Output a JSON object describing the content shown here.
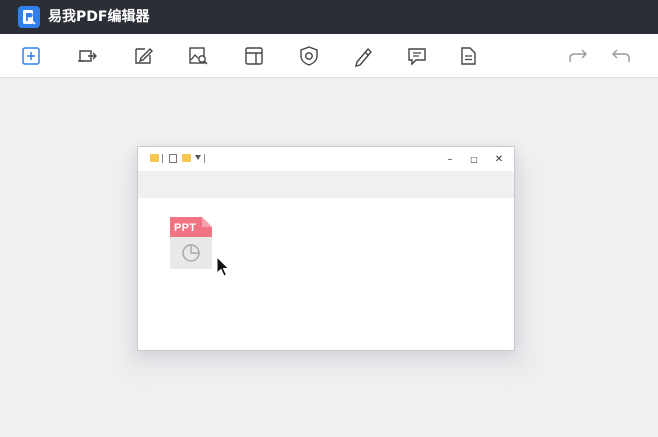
{
  "app": {
    "title": "易我PDF编辑器",
    "accent_color": "#2f80ed",
    "titlebar_color": "#2b2e36"
  },
  "toolbar": {
    "items": [
      {
        "icon": "create-plus-icon",
        "active": true
      },
      {
        "icon": "convert-icon"
      },
      {
        "icon": "edit-pencil-icon"
      },
      {
        "icon": "image-ocr-icon"
      },
      {
        "icon": "page-layout-icon"
      },
      {
        "icon": "protect-shield-icon"
      },
      {
        "icon": "sign-pen-icon"
      },
      {
        "icon": "comment-icon"
      },
      {
        "icon": "form-document-icon"
      }
    ],
    "redo_icon": "redo-icon",
    "undo_icon": "undo-icon"
  },
  "explorer_window": {
    "controls": {
      "minimize": "–",
      "maximize": "□",
      "close": "✕"
    },
    "file": {
      "label": "PPT",
      "icon": "ppt-file-icon",
      "color": "#f07484"
    }
  }
}
